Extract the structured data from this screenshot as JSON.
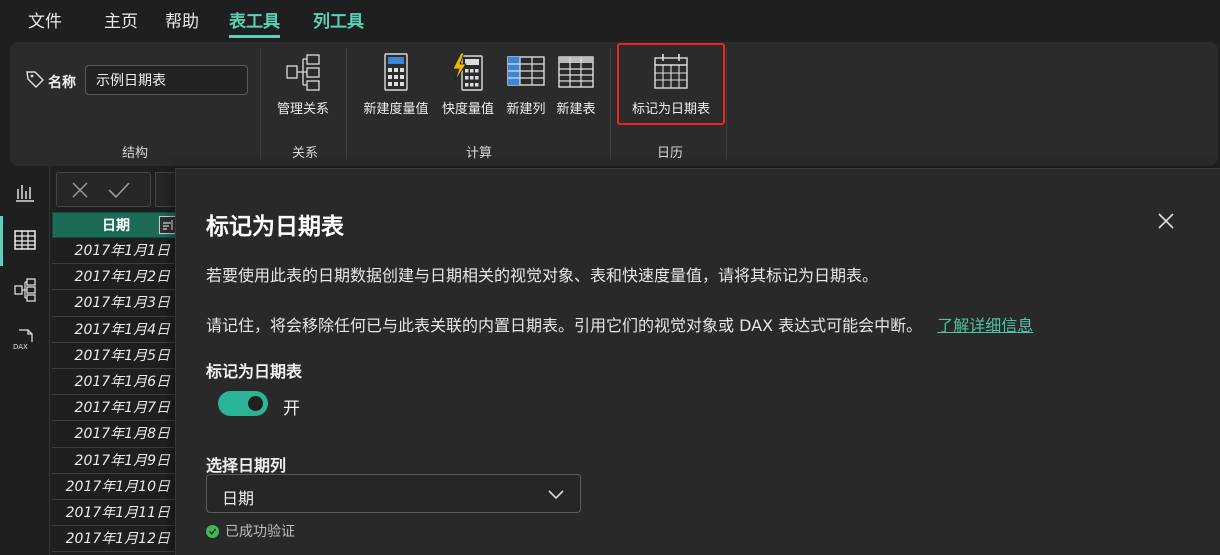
{
  "menu": {
    "file": "文件",
    "home": "主页",
    "help": "帮助",
    "table_tools": "表工具",
    "column_tools": "列工具"
  },
  "ribbon": {
    "name_label": "名称",
    "name_value": "示例日期表",
    "groups": {
      "structure": "结构",
      "relationships": "关系",
      "calculations": "计算",
      "calendars": "日历"
    },
    "buttons": {
      "manage_relationships": "管理关系",
      "new_measure": "新建度量值",
      "quick_measure": "快度量值",
      "new_column": "新建列",
      "new_table": "新建表",
      "mark_as_date_table": "标记为日期表"
    }
  },
  "table": {
    "header": "日期",
    "rows": [
      "2017年1月1日",
      "2017年1月2日",
      "2017年1月3日",
      "2017年1月4日",
      "2017年1月5日",
      "2017年1月6日",
      "2017年1月7日",
      "2017年1月8日",
      "2017年1月9日",
      "2017年1月10日",
      "2017年1月11日",
      "2017年1月12日"
    ]
  },
  "dialog": {
    "title": "标记为日期表",
    "para1": "若要使用此表的日期数据创建与日期相关的视觉对象、表和快速度量值，请将其标记为日期表。",
    "para2": "请记住，将会移除任何已与此表关联的内置日期表。引用它们的视觉对象或 DAX 表达式可能会中断。",
    "learn_more": "了解详细信息",
    "toggle_label": "标记为日期表",
    "toggle_state": "开",
    "select_label": "选择日期列",
    "select_value": "日期",
    "validation": "已成功验证"
  },
  "colors": {
    "accent": "#5ad1b8",
    "toggle_on": "#2bb395",
    "highlight_border": "#e8281e",
    "table_header": "#1c6b57"
  }
}
